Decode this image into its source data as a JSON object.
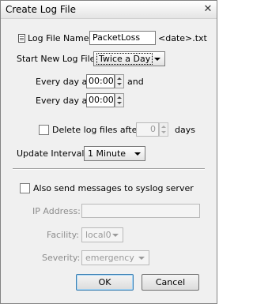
{
  "window": {
    "title": "Create Log File",
    "close_glyph": "✕"
  },
  "log_file": {
    "label": "Log File Name:",
    "value": "PacketLoss",
    "suffix": "<date>.txt"
  },
  "start_new": {
    "label": "Start New Log File:",
    "selected": "Twice a Day"
  },
  "schedule": [
    {
      "prefix": "Every day at",
      "time": "00:00",
      "suffix": "and"
    },
    {
      "prefix": "Every day at",
      "time": "00:00",
      "suffix": ""
    }
  ],
  "delete_old": {
    "label": "Delete log files after",
    "checked": false,
    "value": "0",
    "unit": "days"
  },
  "update_interval": {
    "label": "Update Interval:",
    "selected": "1 Minute"
  },
  "syslog": {
    "checkbox_label": "Also send messages to syslog server",
    "checked": false,
    "ip_label": "IP Address:",
    "ip_value": "",
    "facility_label": "Facility:",
    "facility_value": "local0",
    "severity_label": "Severity:",
    "severity_value": "emergency"
  },
  "buttons": {
    "ok": "OK",
    "cancel": "Cancel"
  },
  "icons": {
    "log_file": "document-icon"
  }
}
